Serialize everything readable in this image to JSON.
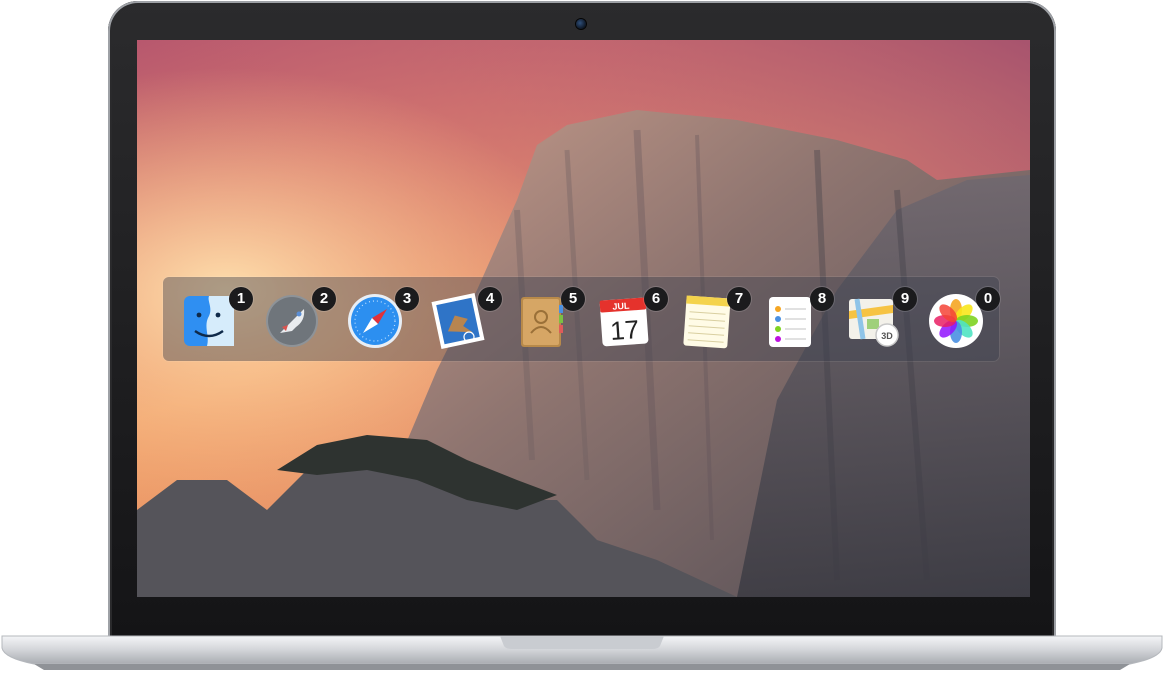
{
  "switcher": {
    "apps": [
      {
        "name": "Finder",
        "icon": "finder-icon",
        "shortcut": "1"
      },
      {
        "name": "Launchpad",
        "icon": "launchpad-rocket-icon",
        "shortcut": "2"
      },
      {
        "name": "Safari",
        "icon": "safari-compass-icon",
        "shortcut": "3"
      },
      {
        "name": "Mail",
        "icon": "mail-stamp-icon",
        "shortcut": "4"
      },
      {
        "name": "Contacts",
        "icon": "contacts-book-icon",
        "shortcut": "5"
      },
      {
        "name": "Calendar",
        "icon": "calendar-icon",
        "shortcut": "6",
        "month": "JUL",
        "day": "17"
      },
      {
        "name": "Notes",
        "icon": "notes-pad-icon",
        "shortcut": "7"
      },
      {
        "name": "Reminders",
        "icon": "reminders-list-icon",
        "shortcut": "8"
      },
      {
        "name": "Maps",
        "icon": "maps-icon",
        "shortcut": "9",
        "label3d": "3D"
      },
      {
        "name": "Photos",
        "icon": "photos-flower-icon",
        "shortcut": "0"
      }
    ]
  }
}
